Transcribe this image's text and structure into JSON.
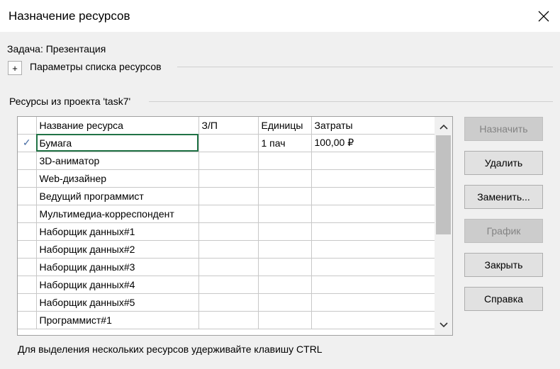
{
  "window": {
    "title": "Назначение ресурсов"
  },
  "task": {
    "text": "Задача: Презентация"
  },
  "options": {
    "expander_symbol": "+",
    "label": "Параметры списка ресурсов"
  },
  "group": {
    "label": "Ресурсы из проекта 'task7'"
  },
  "grid": {
    "columns": [
      "Название ресурса",
      "З/П",
      "Единицы",
      "Затраты"
    ],
    "rows": [
      {
        "mark": "✓",
        "name": "Бумага",
        "rate": "",
        "units": "1 пач",
        "cost": "100,00 ₽"
      },
      {
        "mark": "",
        "name": "3D-аниматор",
        "rate": "",
        "units": "",
        "cost": ""
      },
      {
        "mark": "",
        "name": "Web-дизайнер",
        "rate": "",
        "units": "",
        "cost": ""
      },
      {
        "mark": "",
        "name": "Ведущий программист",
        "rate": "",
        "units": "",
        "cost": ""
      },
      {
        "mark": "",
        "name": "Мультимедиа-корреспондент",
        "rate": "",
        "units": "",
        "cost": ""
      },
      {
        "mark": "",
        "name": "Наборщик данных#1",
        "rate": "",
        "units": "",
        "cost": ""
      },
      {
        "mark": "",
        "name": "Наборщик данных#2",
        "rate": "",
        "units": "",
        "cost": ""
      },
      {
        "mark": "",
        "name": "Наборщик данных#3",
        "rate": "",
        "units": "",
        "cost": ""
      },
      {
        "mark": "",
        "name": "Наборщик данных#4",
        "rate": "",
        "units": "",
        "cost": ""
      },
      {
        "mark": "",
        "name": "Наборщик данных#5",
        "rate": "",
        "units": "",
        "cost": ""
      },
      {
        "mark": "",
        "name": "Программист#1",
        "rate": "",
        "units": "",
        "cost": ""
      }
    ]
  },
  "buttons": {
    "assign": "Назначить",
    "remove": "Удалить",
    "replace": "Заменить...",
    "graph": "График",
    "close": "Закрыть",
    "help": "Справка"
  },
  "hint": {
    "text": "Для выделения нескольких ресурсов удерживайте клавишу CTRL"
  },
  "icons": {
    "close": "close-icon",
    "scroll_up": "chevron-up-icon",
    "scroll_down": "chevron-down-icon",
    "check": "check-icon"
  },
  "colors": {
    "active_cell_border": "#217346",
    "check_mark": "#4a6fa5",
    "disabled_text": "#838383"
  }
}
